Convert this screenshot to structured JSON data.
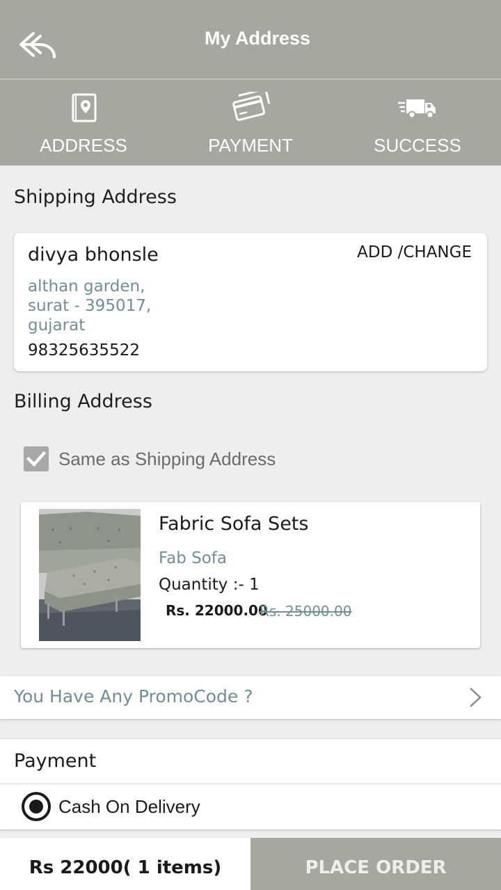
{
  "header": {
    "title": "My Address",
    "back_icon": "back-arrow-icon"
  },
  "steps": [
    {
      "label": "ADDRESS",
      "icon": "address-book-icon"
    },
    {
      "label": "PAYMENT",
      "icon": "credit-card-icon"
    },
    {
      "label": "SUCCESS",
      "icon": "delivery-truck-icon"
    }
  ],
  "shipping": {
    "section_title": "Shipping Address",
    "name": "divya bhonsle",
    "change_label": "ADD /CHANGE",
    "address_lines": [
      "althan garden,",
      "surat - 395017,",
      "gujarat"
    ],
    "phone": "98325635522"
  },
  "billing": {
    "section_title": "Billing Address",
    "same_as_shipping_label": "Same as Shipping Address",
    "same_as_shipping_checked": true
  },
  "product": {
    "name": "Fabric Sofa Sets",
    "brand": "Fab Sofa",
    "quantity": "Quantity :- 1",
    "price": "Rs. 22000.00",
    "original_price": "Rs. 25000.00"
  },
  "promo": {
    "label": "You Have Any PromoCode ?"
  },
  "payment": {
    "section_title": "Payment",
    "option_label": "Cash On Delivery",
    "selected": true
  },
  "footer": {
    "total": "Rs 22000( 1 items)",
    "place_order_label": "PLACE ORDER"
  },
  "colors": {
    "header_bg": "#a7a79f",
    "accent_text": "#6e8e9a",
    "page_bg": "#eeeeee"
  }
}
